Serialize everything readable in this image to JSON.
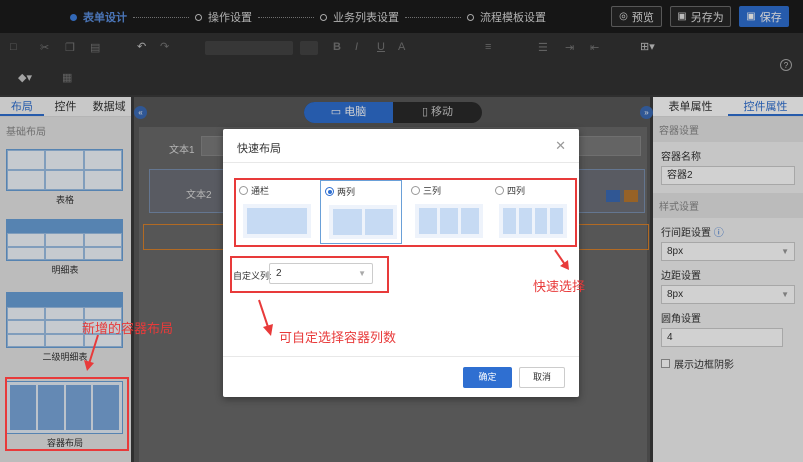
{
  "steps": [
    {
      "label": "表单设计",
      "active": true
    },
    {
      "label": "操作设置",
      "active": false
    },
    {
      "label": "业务列表设置",
      "active": false
    },
    {
      "label": "流程模板设置",
      "active": false
    }
  ],
  "topbar": {
    "preview": "预览",
    "save_as": "另存为",
    "save": "保存"
  },
  "toolbar": {
    "help": "?"
  },
  "left": {
    "tabs": [
      "布局",
      "控件",
      "数据域"
    ],
    "section": "基础布局",
    "items": [
      "表格",
      "明细表",
      "二级明细表",
      "容器布局"
    ],
    "annotation": "新增的容器布局"
  },
  "center": {
    "device_tabs": [
      "电脑",
      "移动"
    ],
    "fields": [
      "文本1",
      "文本2"
    ]
  },
  "right": {
    "tabs": [
      "表单属性",
      "控件属性"
    ],
    "section1": "容器设置",
    "name_label": "容器名称",
    "name_value": "容器2",
    "section2": "样式设置",
    "row_gap_label": "行间距设置",
    "row_gap_value": "8px",
    "margin_label": "边距设置",
    "margin_value": "8px",
    "radius_label": "圆角设置",
    "radius_value": "4",
    "shadow_label": "展示边框阴影"
  },
  "modal": {
    "title": "快速布局",
    "options": [
      {
        "label": "通栏",
        "cols": 1,
        "selected": false
      },
      {
        "label": "两列",
        "cols": 2,
        "selected": true
      },
      {
        "label": "三列",
        "cols": 3,
        "selected": false
      },
      {
        "label": "四列",
        "cols": 4,
        "selected": false
      }
    ],
    "custom_label": "自定义列:",
    "custom_value": "2",
    "ok": "确定",
    "cancel": "取消"
  },
  "annotations": {
    "quick": "快速选择",
    "custom": "可自定选择容器列数"
  }
}
